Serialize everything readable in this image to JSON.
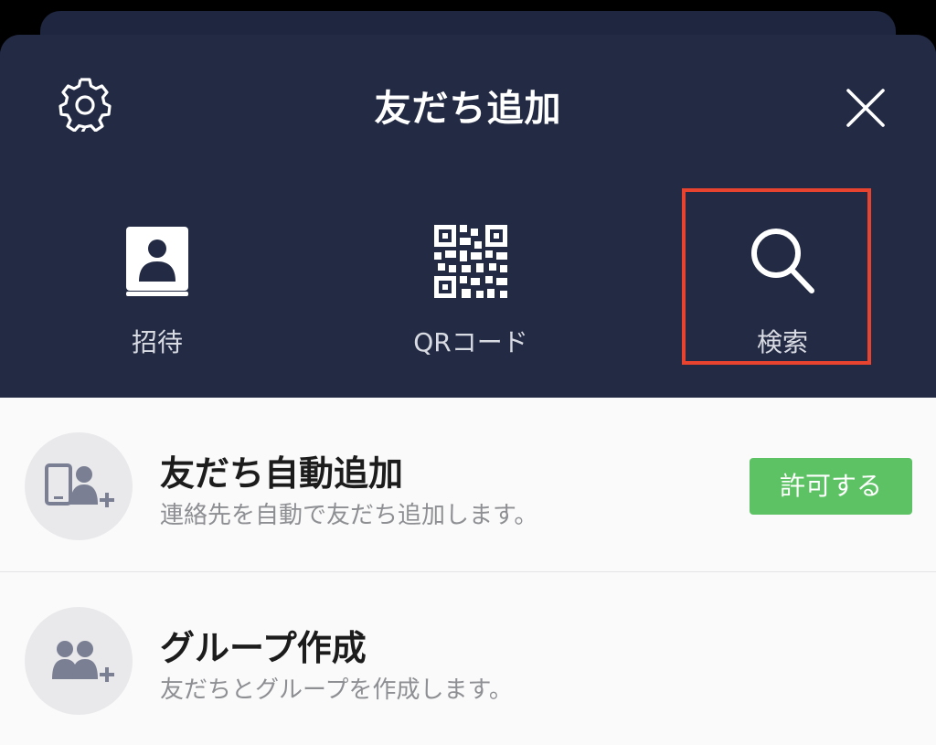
{
  "header": {
    "title": "友だち追加",
    "settings_icon": "gear-icon",
    "close_icon": "close-icon"
  },
  "actions": [
    {
      "label": "招待",
      "icon": "contact-book-icon"
    },
    {
      "label": "QRコード",
      "icon": "qr-code-icon"
    },
    {
      "label": "検索",
      "icon": "search-icon",
      "highlighted": true
    }
  ],
  "rows": [
    {
      "title": "友だち自動追加",
      "subtitle": "連絡先を自動で友だち追加します。",
      "icon": "phone-add-friends-icon",
      "button_label": "許可する"
    },
    {
      "title": "グループ作成",
      "subtitle": "友だちとグループを作成します。",
      "icon": "add-group-icon"
    }
  ],
  "colors": {
    "header_bg": "#232a44",
    "highlight_border": "#e8432e",
    "allow_button": "#5dc264",
    "content_bg": "#fafafa"
  }
}
